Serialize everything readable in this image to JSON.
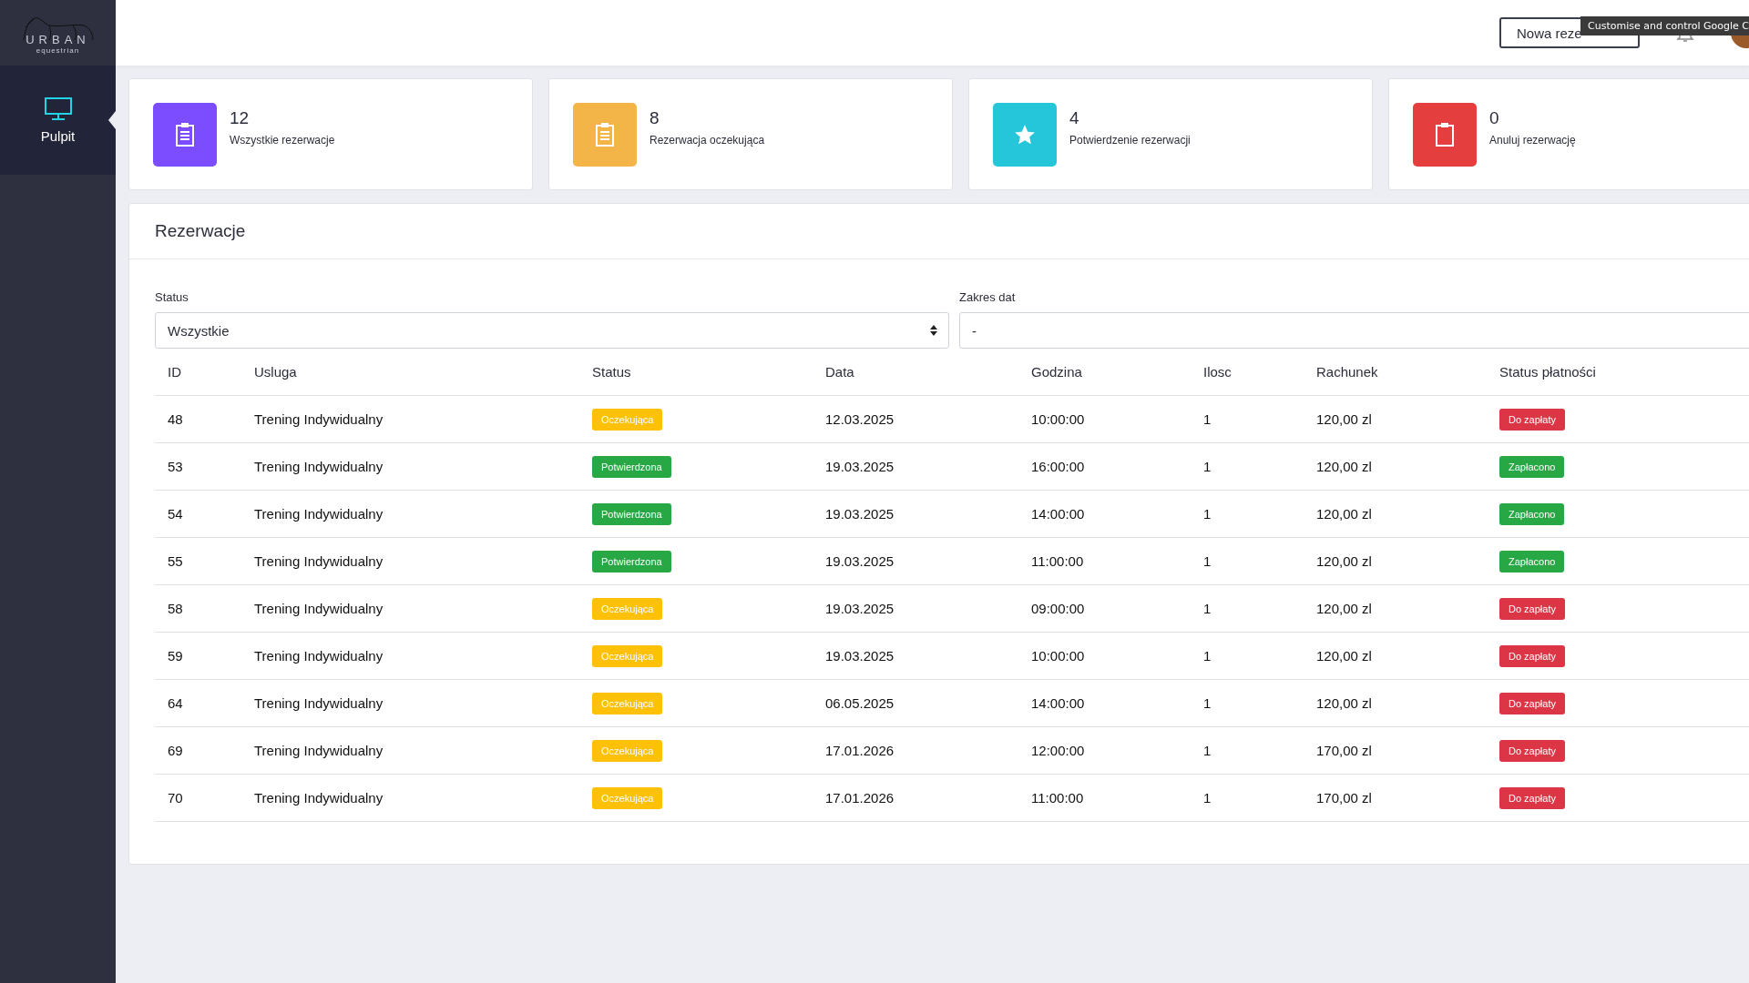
{
  "logo": {
    "name": "URBAN",
    "tagline": "equestrian"
  },
  "sidebar": {
    "items": [
      {
        "label": "Pulpit",
        "selected": true
      }
    ]
  },
  "header": {
    "new_button": "Nowa reze",
    "tooltip": "Customise and control Google C"
  },
  "stats": [
    {
      "value": "12",
      "label": "Wszystkie rezerwacje",
      "color": "#7c4dff",
      "kind": "list"
    },
    {
      "value": "8",
      "label": "Rezerwacja oczekująca",
      "color": "#f4b548",
      "kind": "list"
    },
    {
      "value": "4",
      "label": "Potwierdzenie rezerwacji",
      "color": "#26c6da",
      "kind": "star"
    },
    {
      "value": "0",
      "label": "Anuluj rezerwację",
      "color": "#e53e3e",
      "kind": "clipboard"
    }
  ],
  "panel": {
    "title": "Rezerwacje",
    "filters": [
      {
        "label": "Status",
        "kind": "select",
        "value": "Wszystkie"
      },
      {
        "label": "Zakres dat",
        "kind": "text",
        "value": "-"
      }
    ],
    "table": {
      "columns": [
        "ID",
        "Usluga",
        "Status",
        "Data",
        "Godzina",
        "Ilosc",
        "Rachunek",
        "Status płatności"
      ],
      "rows": [
        {
          "id": "48",
          "service": "Trening Indywidualny",
          "status": {
            "label": "Oczekująca",
            "color": "#ffc107"
          },
          "date": "12.03.2025",
          "time": "10:00:00",
          "qty": "1",
          "amount": "120,00 zl",
          "payment": {
            "label": "Do zapłaty",
            "color": "#dc3545"
          }
        },
        {
          "id": "53",
          "service": "Trening Indywidualny",
          "status": {
            "label": "Potwierdzona",
            "color": "#28a745"
          },
          "date": "19.03.2025",
          "time": "16:00:00",
          "qty": "1",
          "amount": "120,00 zl",
          "payment": {
            "label": "Zapłacono",
            "color": "#28a745"
          }
        },
        {
          "id": "54",
          "service": "Trening Indywidualny",
          "status": {
            "label": "Potwierdzona",
            "color": "#28a745"
          },
          "date": "19.03.2025",
          "time": "14:00:00",
          "qty": "1",
          "amount": "120,00 zl",
          "payment": {
            "label": "Zapłacono",
            "color": "#28a745"
          }
        },
        {
          "id": "55",
          "service": "Trening Indywidualny",
          "status": {
            "label": "Potwierdzona",
            "color": "#28a745"
          },
          "date": "19.03.2025",
          "time": "11:00:00",
          "qty": "1",
          "amount": "120,00 zl",
          "payment": {
            "label": "Zapłacono",
            "color": "#28a745"
          }
        },
        {
          "id": "58",
          "service": "Trening Indywidualny",
          "status": {
            "label": "Oczekująca",
            "color": "#ffc107"
          },
          "date": "19.03.2025",
          "time": "09:00:00",
          "qty": "1",
          "amount": "120,00 zl",
          "payment": {
            "label": "Do zapłaty",
            "color": "#dc3545"
          }
        },
        {
          "id": "59",
          "service": "Trening Indywidualny",
          "status": {
            "label": "Oczekująca",
            "color": "#ffc107"
          },
          "date": "19.03.2025",
          "time": "10:00:00",
          "qty": "1",
          "amount": "120,00 zl",
          "payment": {
            "label": "Do zapłaty",
            "color": "#dc3545"
          }
        },
        {
          "id": "64",
          "service": "Trening Indywidualny",
          "status": {
            "label": "Oczekująca",
            "color": "#ffc107"
          },
          "date": "06.05.2025",
          "time": "14:00:00",
          "qty": "1",
          "amount": "120,00 zl",
          "payment": {
            "label": "Do zapłaty",
            "color": "#dc3545"
          }
        },
        {
          "id": "69",
          "service": "Trening Indywidualny",
          "status": {
            "label": "Oczekująca",
            "color": "#ffc107"
          },
          "date": "17.01.2026",
          "time": "12:00:00",
          "qty": "1",
          "amount": "170,00 zl",
          "payment": {
            "label": "Do zapłaty",
            "color": "#dc3545"
          }
        },
        {
          "id": "70",
          "service": "Trening Indywidualny",
          "status": {
            "label": "Oczekująca",
            "color": "#ffc107"
          },
          "date": "17.01.2026",
          "time": "11:00:00",
          "qty": "1",
          "amount": "170,00 zl",
          "payment": {
            "label": "Do zapłaty",
            "color": "#dc3545"
          }
        }
      ]
    }
  }
}
